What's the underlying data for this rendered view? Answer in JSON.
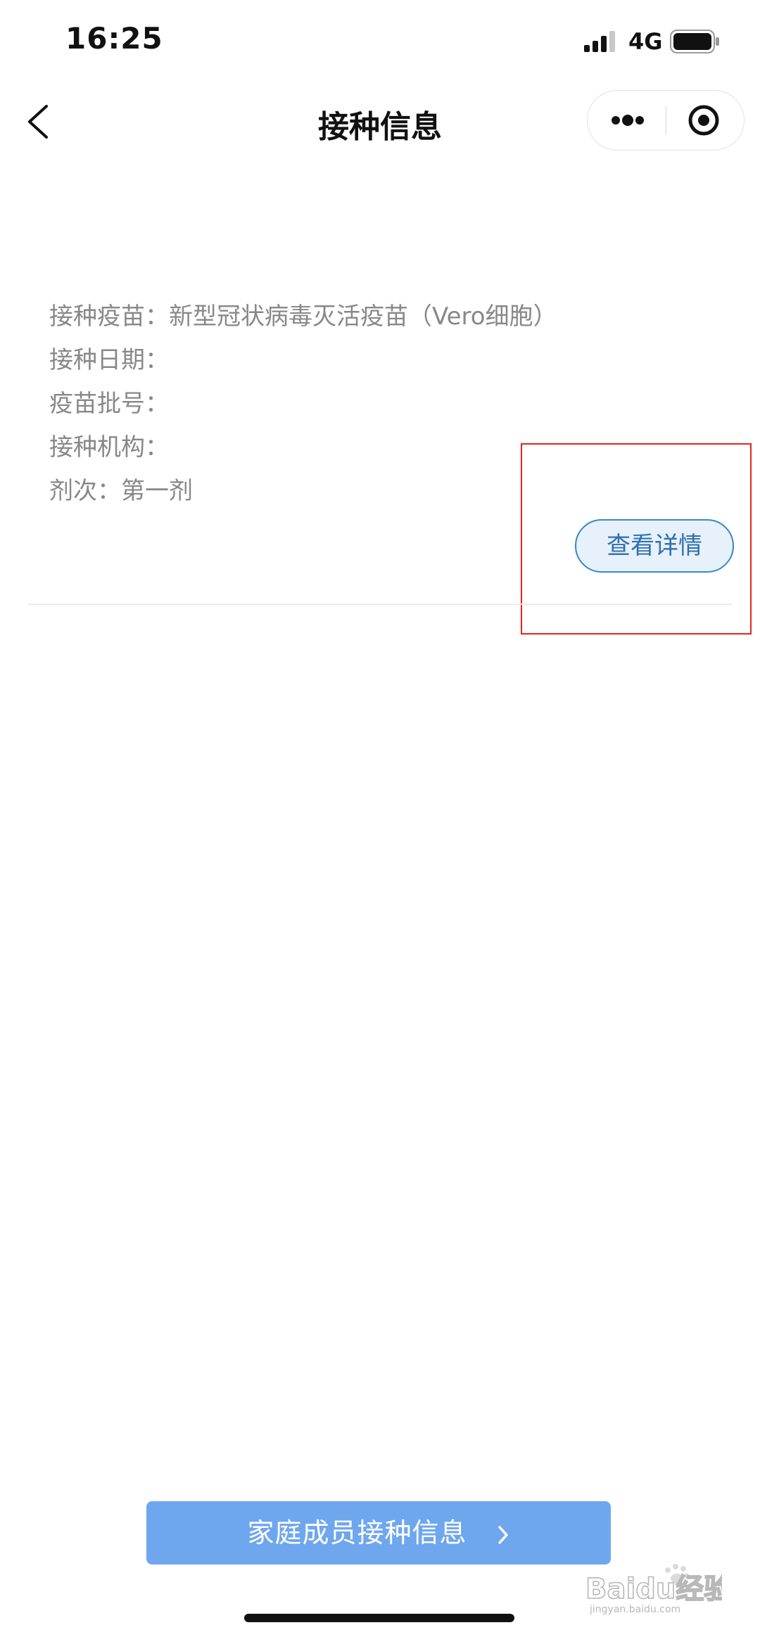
{
  "status_bar": {
    "time": "16:25",
    "network": "4G"
  },
  "nav": {
    "title": "接种信息"
  },
  "vaccination": {
    "vaccine_label": "接种疫苗：新型冠状病毒灭活疫苗（Vero细胞）",
    "date_label": "接种日期：",
    "batch_label": "疫苗批号：",
    "institution_label": "接种机构：",
    "dose_label": "剂次：第一剂"
  },
  "detail_button": {
    "label": "查看详情"
  },
  "family_button": {
    "label": "家庭成员接种信息"
  },
  "watermark": {
    "text": "Baidu经验",
    "subtext": "jingyan.baidu.com"
  },
  "colors": {
    "primary_blue": "#6fa7ee",
    "detail_border": "#3a86c8",
    "highlight_red": "#e8231f",
    "label_gray": "#888888"
  },
  "icons": {
    "back": "chevron-left-icon",
    "more": "more-dots-icon",
    "close": "target-close-icon",
    "signal": "signal-bars-icon",
    "battery": "battery-icon"
  }
}
